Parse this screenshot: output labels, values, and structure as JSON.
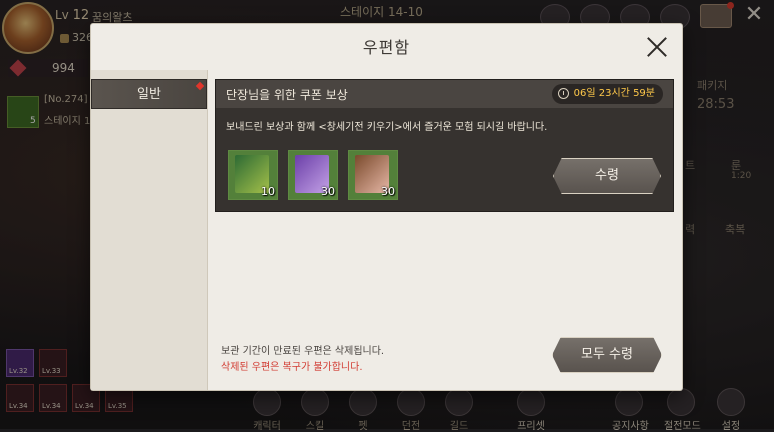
{
  "hud": {
    "level_prefix": "Lv",
    "level": "12",
    "player_name": "꿈의왈츠",
    "power": "326",
    "gems": "994",
    "quest_tag": "[No.274]",
    "quest_stage": "스테이지 1",
    "book_count": "5",
    "stage_title_prefix": "스테이지",
    "stage_title_value": "14-10"
  },
  "side_right": {
    "pkg": "패키지",
    "timer": "28:53",
    "item1": "트",
    "item2": "룬",
    "item2_time": "1:20",
    "item3": "력",
    "item4": "축복"
  },
  "bottom_slots": [
    "Lv.32",
    "Lv.33",
    "Lv.34",
    "Lv.34",
    "Lv.34",
    "Lv.35"
  ],
  "bottom_bar": {
    "items": [
      "캐릭터",
      "스킬",
      "펫",
      "던전",
      "길드",
      "프리셋"
    ],
    "right_items": [
      "공지사항",
      "절전모드",
      "설정"
    ]
  },
  "mailbox": {
    "title": "우편함",
    "tabs": [
      {
        "label": "일반",
        "has_new": true
      }
    ],
    "mails": [
      {
        "title": "단장님을 위한 쿠폰 보상",
        "time_left": "06일 23시간 59분",
        "body": "보내드린 보상과 함께 <창세기전 키우기>에서 즐거운 모험 되시길 바랍니다.",
        "rewards": [
          {
            "icon": "green-book-icon",
            "qty": "10"
          },
          {
            "icon": "purple-book-icon",
            "qty": "30"
          },
          {
            "icon": "pink-book-icon",
            "qty": "30"
          }
        ],
        "claim_label": "수령"
      }
    ],
    "footer_note": "보관 기간이 만료된 우편은 삭제됩니다.",
    "footer_warning": "삭제된 우편은 복구가 불가합니다.",
    "claim_all_label": "모두 수령"
  },
  "colors": {
    "accent_warning": "#d23c32",
    "timer_text": "#ffc94a",
    "new_dot": "#e0352b"
  }
}
